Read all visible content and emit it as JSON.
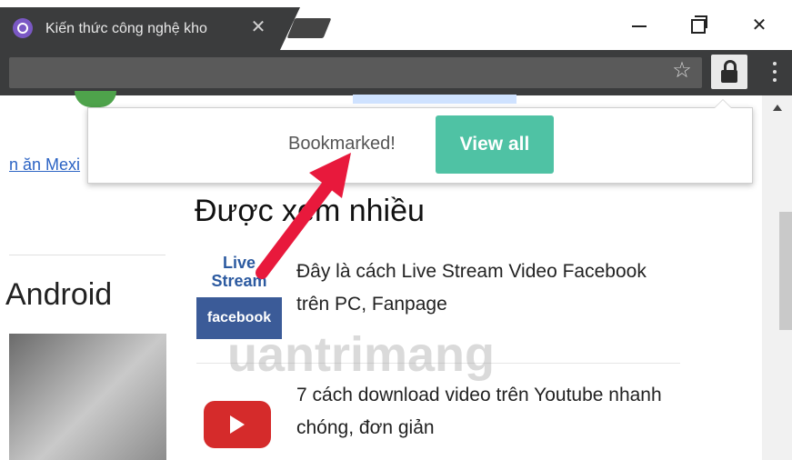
{
  "tab": {
    "title": "Kiến thức công nghệ kho",
    "close": "✕"
  },
  "window": {
    "minimize": "",
    "maximize": "",
    "close": "✕"
  },
  "toolbar": {
    "star": "☆"
  },
  "popup": {
    "message": "Bookmarked!",
    "button": "View all"
  },
  "left": {
    "link": "n ăn Mexi",
    "heading": "Android"
  },
  "section": {
    "title": "Được xem nhiều"
  },
  "items": [
    {
      "thumb_line1": "Live",
      "thumb_line2": "Stream",
      "thumb_brand": "facebook",
      "text": "Đây là cách Live Stream Video Facebook trên PC, Fanpage"
    },
    {
      "text": "7 cách download video trên Youtube nhanh chóng, đơn giản"
    }
  ],
  "watermark": "uantrimang",
  "colors": {
    "accent": "#4fc2a4",
    "arrow": "#e8193c",
    "chrome": "#3b3c3d"
  },
  "icons": {
    "tab_favicon": "quantrimang-icon",
    "star": "star-icon",
    "lock": "lock-icon",
    "menu": "menu-dots-icon"
  }
}
